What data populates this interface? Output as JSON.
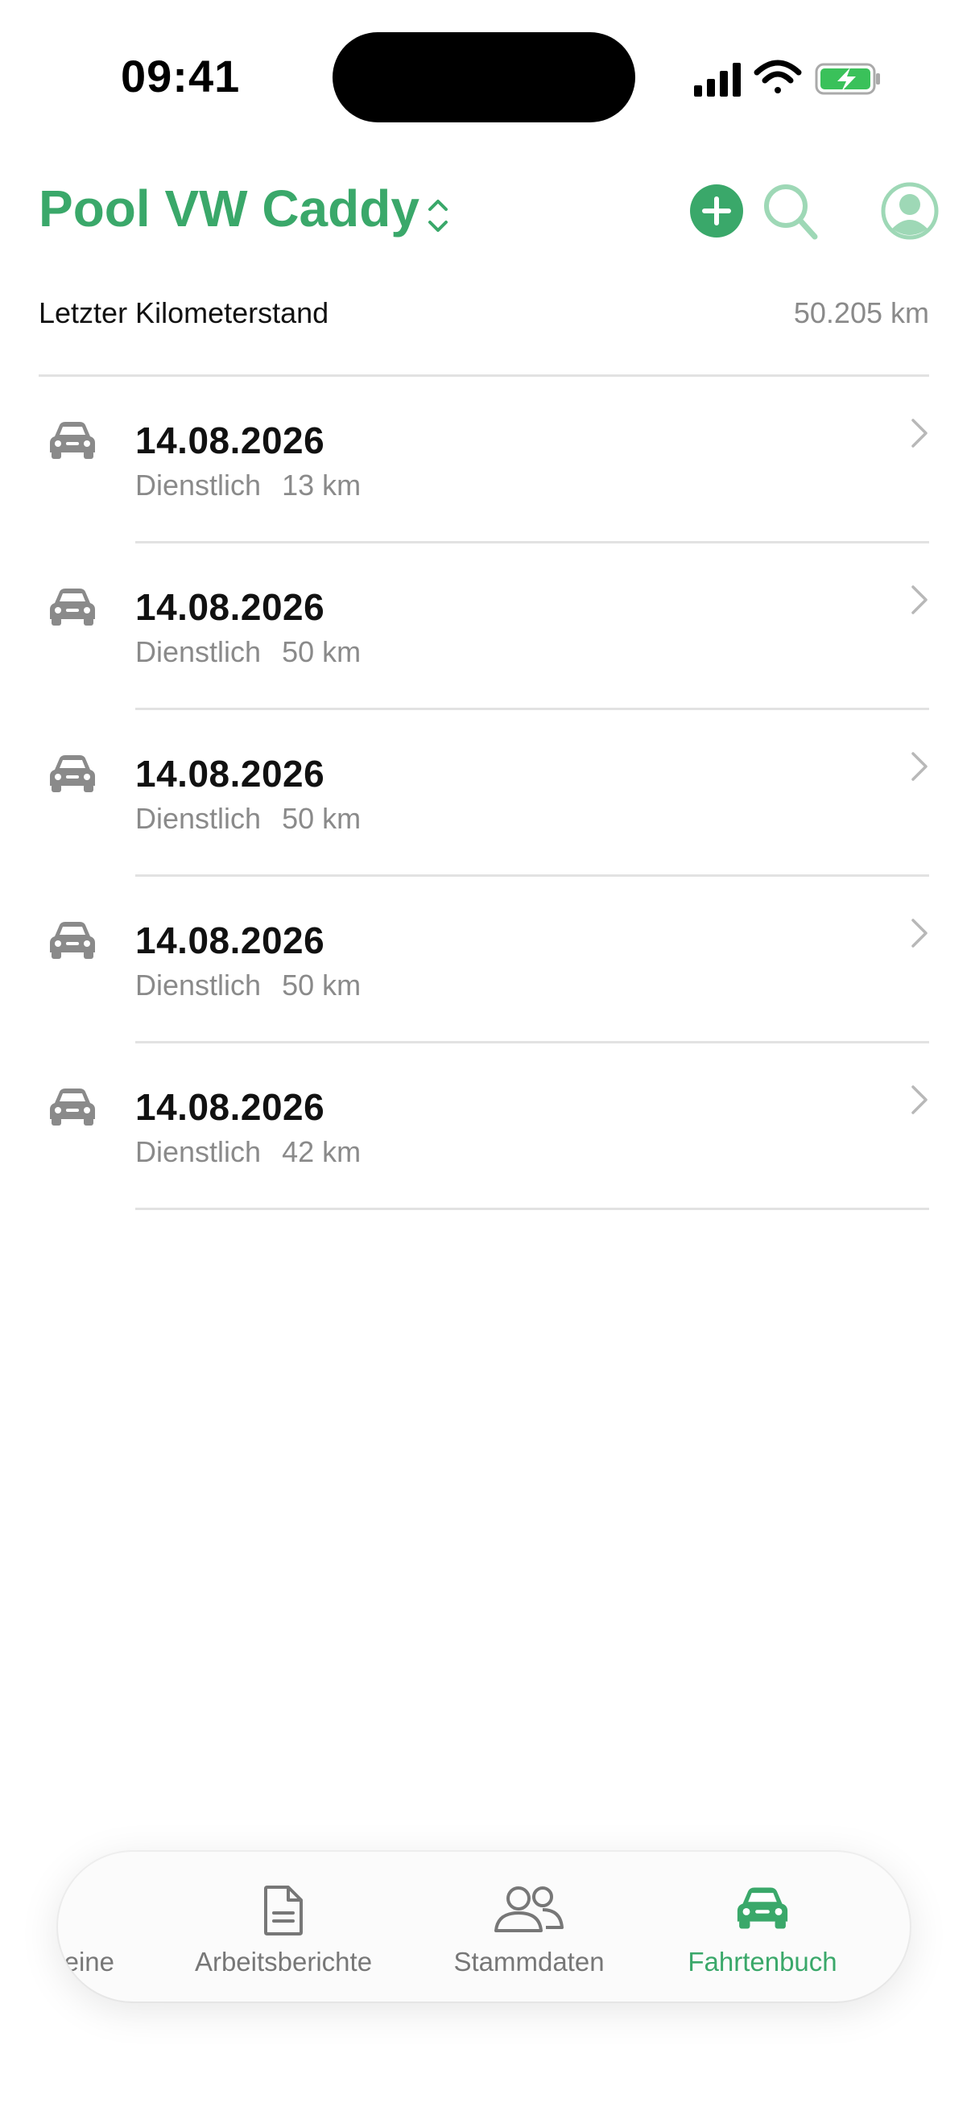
{
  "status_bar": {
    "time": "09:41"
  },
  "header": {
    "title": "Pool VW Caddy"
  },
  "odometer": {
    "label": "Letzter Kilometerstand",
    "value": "50.205 km"
  },
  "trips": [
    {
      "date": "14.08.2026",
      "type": "Dienstlich",
      "distance": "13 km"
    },
    {
      "date": "14.08.2026",
      "type": "Dienstlich",
      "distance": "50 km"
    },
    {
      "date": "14.08.2026",
      "type": "Dienstlich",
      "distance": "50 km"
    },
    {
      "date": "14.08.2026",
      "type": "Dienstlich",
      "distance": "50 km"
    },
    {
      "date": "14.08.2026",
      "type": "Dienstlich",
      "distance": "42 km"
    }
  ],
  "tabbar": {
    "tabs": [
      {
        "label": "eine",
        "icon": "partial-tab",
        "active": false
      },
      {
        "label": "Arbeitsberichte",
        "icon": "document-icon",
        "active": false
      },
      {
        "label": "Stammdaten",
        "icon": "people-icon",
        "active": false
      },
      {
        "label": "Fahrtenbuch",
        "icon": "car-icon",
        "active": true
      }
    ]
  },
  "colors": {
    "accent": "#3aa86a",
    "accent_light": "#9ed8b6",
    "secondary_text": "#8a8a8a",
    "separator": "#e2e2e2"
  }
}
